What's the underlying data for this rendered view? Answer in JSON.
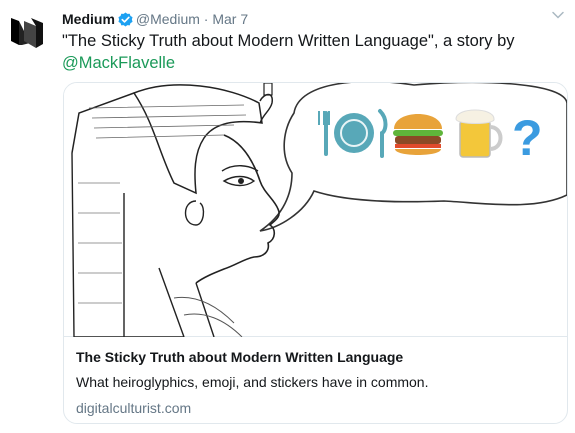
{
  "tweet": {
    "author_name": "Medium",
    "handle": "@Medium",
    "separator": "·",
    "date": "Mar 7",
    "text": "\"The Sticky Truth about Modern Written Language\", a story by",
    "mention": "@MackFlavelle"
  },
  "card": {
    "title": "The Sticky Truth about Modern Written Language",
    "description": "What heiroglyphics, emoji, and stickers have in common.",
    "domain": "digitalculturist.com",
    "image_emoji": [
      "fork-knife-plate",
      "hamburger",
      "beer-mug",
      "question-mark"
    ]
  },
  "colors": {
    "mention": "#1b9a59",
    "verified": "#1da1f2",
    "muted": "#657786",
    "question": "#3b9be0"
  }
}
